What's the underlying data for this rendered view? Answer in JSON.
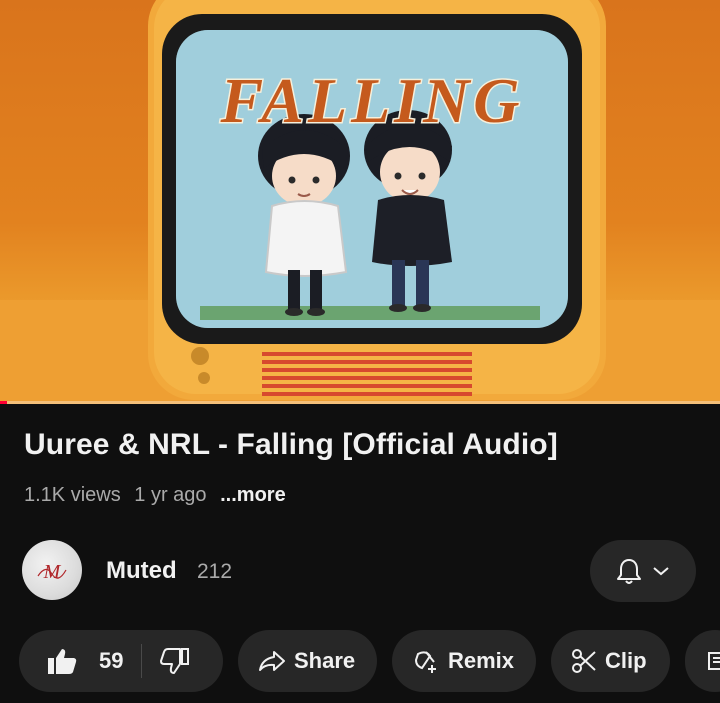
{
  "video": {
    "thumbnail_text": "FALLING",
    "progress_fraction": 0.01
  },
  "title": "Uuree & NRL - Falling [Official Audio]",
  "meta": {
    "views": "1.1K views",
    "age": "1 yr ago",
    "more": "...more"
  },
  "channel": {
    "name": "Muted",
    "subscribers": "212",
    "avatar_text": "M"
  },
  "actions": {
    "like_count": "59",
    "share_label": "Share",
    "remix_label": "Remix",
    "clip_label": "Clip"
  },
  "icons": {
    "notification": "bell-icon",
    "dropdown": "chevron-down-icon",
    "like": "thumb-up-icon",
    "dislike": "thumb-down-icon",
    "share": "share-arrow-icon",
    "remix": "remix-icon",
    "clip": "scissors-icon",
    "save": "save-icon"
  },
  "colors": {
    "background": "#0f0f0f",
    "pill": "#272727",
    "text_primary": "#f1f1f1",
    "text_secondary": "#aaaaaa",
    "tv_body": "#f2a93b",
    "screen": "#a9d5e2",
    "thumbnail_title": "#c55a1d"
  }
}
